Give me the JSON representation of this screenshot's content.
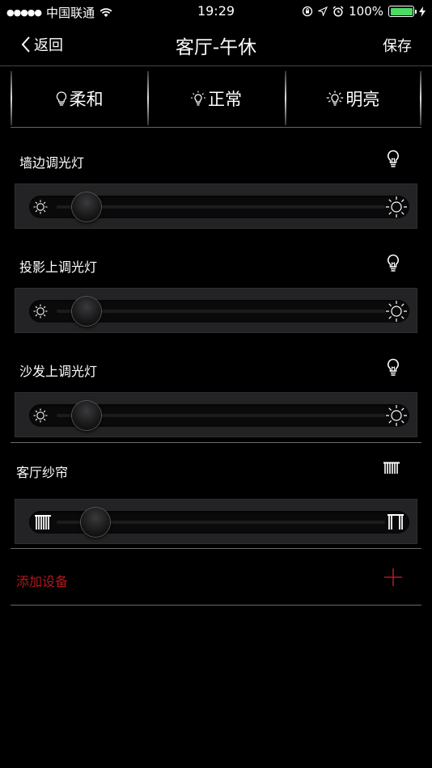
{
  "status_bar": {
    "carrier": "中国联通",
    "time": "19:29",
    "battery": "100%"
  },
  "nav": {
    "back_label": "返回",
    "title": "客厅-午休",
    "save_label": "保存"
  },
  "modes": [
    {
      "label": "柔和",
      "icon": "bulb-soft-icon"
    },
    {
      "label": "正常",
      "icon": "bulb-normal-icon"
    },
    {
      "label": "明亮",
      "icon": "bulb-bright-icon"
    }
  ],
  "devices": [
    {
      "label": "墙边调光灯",
      "icon": "lightbulb-icon",
      "level": 0.05
    },
    {
      "label": "投影上调光灯",
      "icon": "lightbulb-icon",
      "level": 0.05
    },
    {
      "label": "沙发上调光灯",
      "icon": "lightbulb-icon",
      "level": 0.05
    },
    {
      "label": "客厅纱帘",
      "icon": "curtain-icon",
      "level": 0.08
    }
  ],
  "add_device": {
    "label": "添加设备",
    "color": "#b0181e"
  },
  "colors": {
    "accent_red": "#b0181e",
    "battery_green": "#4cd964"
  }
}
